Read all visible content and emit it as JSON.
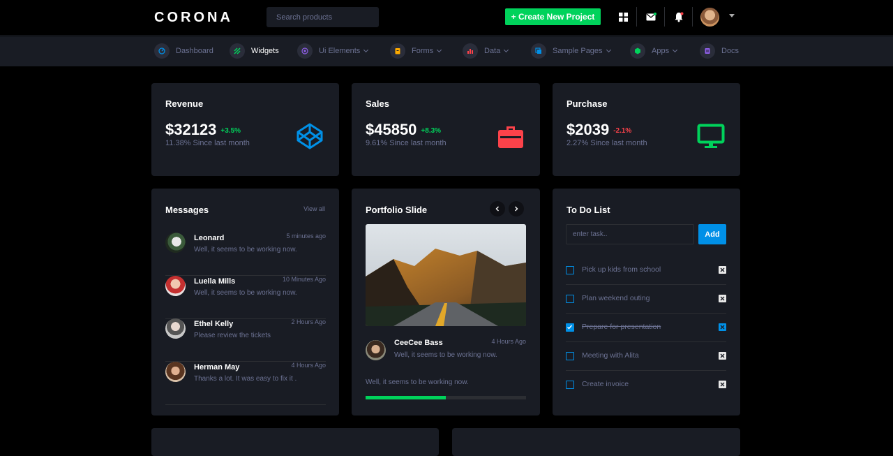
{
  "header": {
    "logo": "CORONA",
    "search_placeholder": "Search products",
    "create_label": "+ Create New Project"
  },
  "nav": [
    {
      "label": "Dashboard",
      "icon": "speedometer-icon",
      "active": false,
      "chevron": false
    },
    {
      "label": "Widgets",
      "icon": "layers-icon",
      "active": true,
      "chevron": false
    },
    {
      "label": "Ui Elements",
      "icon": "atom-icon",
      "active": false,
      "chevron": true
    },
    {
      "label": "Forms",
      "icon": "clipboard-icon",
      "active": false,
      "chevron": true
    },
    {
      "label": "Data",
      "icon": "chart-icon",
      "active": false,
      "chevron": true
    },
    {
      "label": "Sample Pages",
      "icon": "pages-icon",
      "active": false,
      "chevron": true
    },
    {
      "label": "Apps",
      "icon": "apps-icon",
      "active": false,
      "chevron": true
    },
    {
      "label": "Docs",
      "icon": "docs-icon",
      "active": false,
      "chevron": false
    }
  ],
  "stats": [
    {
      "title": "Revenue",
      "value": "$32123",
      "delta": "+3.5%",
      "sub": "11.38% Since last month",
      "icon": "codepen-icon",
      "color": "#0090e7",
      "delta_color": "#00d25b"
    },
    {
      "title": "Sales",
      "value": "$45850",
      "delta": "+8.3%",
      "sub": "9.61% Since last month",
      "icon": "briefcase-icon",
      "color": "#fc424a",
      "delta_color": "#00d25b"
    },
    {
      "title": "Purchase",
      "value": "$2039",
      "delta": "-2.1%",
      "sub": "2.27% Since last month",
      "icon": "monitor-icon",
      "color": "#00d25b",
      "delta_color": "#fc424a"
    }
  ],
  "messages": {
    "title": "Messages",
    "view_all": "View all",
    "items": [
      {
        "name": "Leonard",
        "time": "5 minutes ago",
        "text": "Well, it seems to be working now."
      },
      {
        "name": "Luella Mills",
        "time": "10 Minutes Ago",
        "text": "Well, it seems to be working now."
      },
      {
        "name": "Ethel Kelly",
        "time": "2 Hours Ago",
        "text": "Please review the tickets"
      },
      {
        "name": "Herman May",
        "time": "4 Hours Ago",
        "text": "Thanks a lot. It was easy to fix it ."
      }
    ]
  },
  "portfolio": {
    "title": "Portfolio Slide",
    "author": "CeeCee Bass",
    "time": "4 Hours Ago",
    "text": "Well, it seems to be working now.",
    "caption": "Well, it seems to be working now.",
    "progress": 0.5
  },
  "todo": {
    "title": "To Do List",
    "placeholder": "enter task..",
    "add_label": "Add",
    "items": [
      {
        "text": "Pick up kids from school",
        "done": false
      },
      {
        "text": "Plan weekend outing",
        "done": false
      },
      {
        "text": "Prepare for presentation",
        "done": true
      },
      {
        "text": "Meeting with Alita",
        "done": false
      },
      {
        "text": "Create invoice",
        "done": false
      }
    ]
  }
}
